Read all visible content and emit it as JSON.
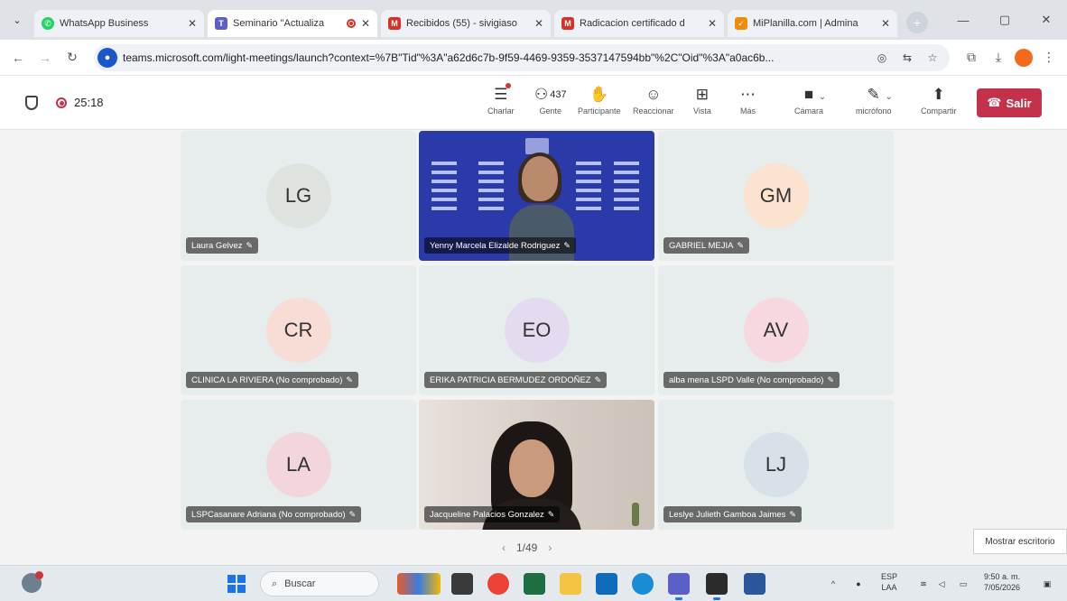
{
  "browser": {
    "tabs": [
      {
        "title": "WhatsApp Business",
        "color": "#25d366",
        "active": false
      },
      {
        "title": "Seminario \"Actualiza",
        "color": "#5b5fc7",
        "active": true,
        "recording": true
      },
      {
        "title": "Recibidos (55) - sivigiaso",
        "color": "#d93025",
        "active": false
      },
      {
        "title": "Radicacion certificado d",
        "color": "#d93025",
        "active": false
      },
      {
        "title": "MiPlanilla.com | Admina",
        "color": "#f28b05",
        "active": false
      }
    ],
    "url": "teams.microsoft.com/light-meetings/launch?context=%7B\"Tid\"%3A\"a62d6c7b-9f59-4469-9359-3537147594bb\"%2C\"Oid\"%3A\"a0ac6b..."
  },
  "meeting": {
    "timer": "25:18",
    "people_count": "437",
    "controls": {
      "chat": "Charlar",
      "people": "Gente",
      "raise": "Participante",
      "react": "Reaccionar",
      "view": "Vista",
      "more": "Más",
      "camera": "Cámara",
      "mic": "micrófono",
      "share": "Compartir"
    },
    "leave_label": "Salir",
    "participants": [
      {
        "initials": "LG",
        "name": "Laura Gelvez",
        "avatar_color": "#dfe3e0"
      },
      {
        "initials": "",
        "name": "Yenny Marcela Elizalde Rodriguez",
        "video": "slides"
      },
      {
        "initials": "GM",
        "name": "GABRIEL MEJIA",
        "avatar_color": "#fbe3cf"
      },
      {
        "initials": "CR",
        "name": "CLINICA LA RIVIERA (No comprobado)",
        "avatar_color": "#f8dcd6"
      },
      {
        "initials": "EO",
        "name": "ERIKA PATRICIA BERMUDEZ ORDOÑEZ",
        "avatar_color": "#e4dbf0"
      },
      {
        "initials": "AV",
        "name": "alba mena LSPD Valle (No comprobado)",
        "avatar_color": "#f7d8e0"
      },
      {
        "initials": "LA",
        "name": "LSPCasanare Adriana (No comprobado)",
        "avatar_color": "#f3d6dc"
      },
      {
        "initials": "",
        "name": "Jacqueline Palacios Gonzalez",
        "video": "camera"
      },
      {
        "initials": "LJ",
        "name": "Leslye Julieth Gamboa Jaimes",
        "avatar_color": "#d9e1e8"
      }
    ],
    "page": "1/49",
    "show_desktop": "Mostrar escritorio"
  },
  "taskbar": {
    "search_placeholder": "Buscar",
    "language": "ESP",
    "language_sub": "LAA",
    "time": "9:50 a. m.",
    "date": "7/05/2026"
  }
}
